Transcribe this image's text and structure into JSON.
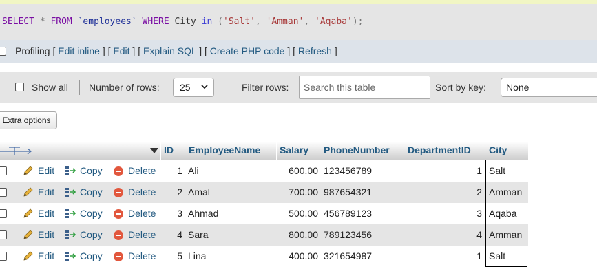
{
  "sql": {
    "select_kw": "SELECT",
    "star": "*",
    "from_kw": "FROM",
    "table": "`employees`",
    "where_kw": "WHERE",
    "column": "City",
    "in_kw": "in",
    "open_paren": "(",
    "value1": "'Salt'",
    "comma1": ",",
    "value2": "'Amman'",
    "comma2": ",",
    "value3": "'Aqaba'",
    "close_paren": ");"
  },
  "profiling": {
    "label": "Profiling",
    "links": [
      "Edit inline",
      "Edit",
      "Explain SQL",
      "Create PHP code",
      "Refresh"
    ]
  },
  "nav": {
    "show_all_label": "Show all",
    "rows_label": "Number of rows:",
    "rows_value": "25",
    "filter_label": "Filter rows:",
    "filter_placeholder": "Search this table",
    "sort_label": "Sort by key:",
    "sort_value": "None"
  },
  "extra_options_label": "Extra options",
  "table": {
    "columns": [
      "ID",
      "EmployeeName",
      "Salary",
      "PhoneNumber",
      "DepartmentID",
      "City"
    ],
    "action_labels": {
      "edit": "Edit",
      "copy": "Copy",
      "delete": "Delete"
    },
    "rows": [
      {
        "id": "1",
        "name": "Ali",
        "salary": "600.00",
        "phone": "123456789",
        "dept": "1",
        "city": "Salt"
      },
      {
        "id": "2",
        "name": "Amal",
        "salary": "700.00",
        "phone": "987654321",
        "dept": "2",
        "city": "Amman"
      },
      {
        "id": "3",
        "name": "Ahmad",
        "salary": "500.00",
        "phone": "456789123",
        "dept": "3",
        "city": "Aqaba"
      },
      {
        "id": "4",
        "name": "Sara",
        "salary": "800.00",
        "phone": "789123456",
        "dept": "4",
        "city": "Amman"
      },
      {
        "id": "5",
        "name": "Lina",
        "salary": "400.00",
        "phone": "321654987",
        "dept": "1",
        "city": "Salt"
      }
    ]
  },
  "colors": {
    "link": "#235a81",
    "keyword": "#7a0ea3",
    "string": "#a83a3a",
    "delete_icon": "#e2573d",
    "row_alt": "#e5e5e5"
  },
  "icons": [
    "pencil-icon",
    "copy-icon",
    "delete-icon",
    "sort-arrows-icon",
    "chevron-down-icon"
  ]
}
